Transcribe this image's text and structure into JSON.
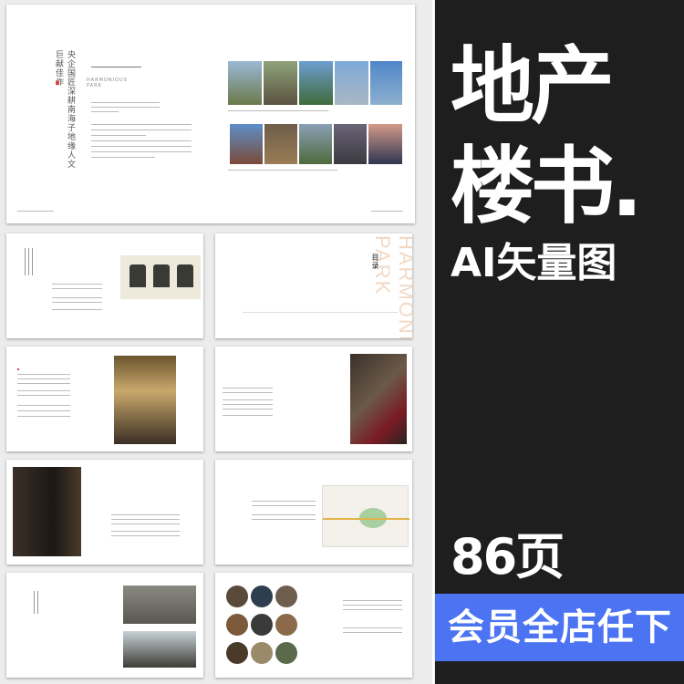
{
  "hero": {
    "title_line1": "地产",
    "title_line2": "楼书.",
    "subtitle": "AI矢量图",
    "page_count": "86页",
    "banner": "会员全店任下"
  },
  "thumbnails": {
    "cover_vertical_1": "央企国匠深耕南海子地缘人文",
    "cover_vertical_2": "巨献佳作",
    "cover_heading": "HARMONIOUS PARK",
    "watermark": "HARMONIOUS PARK",
    "toc_title": "目录"
  },
  "colors": {
    "panel": "#1e1e1e",
    "banner": "#4c74f2",
    "accent_red": "#d44444"
  }
}
